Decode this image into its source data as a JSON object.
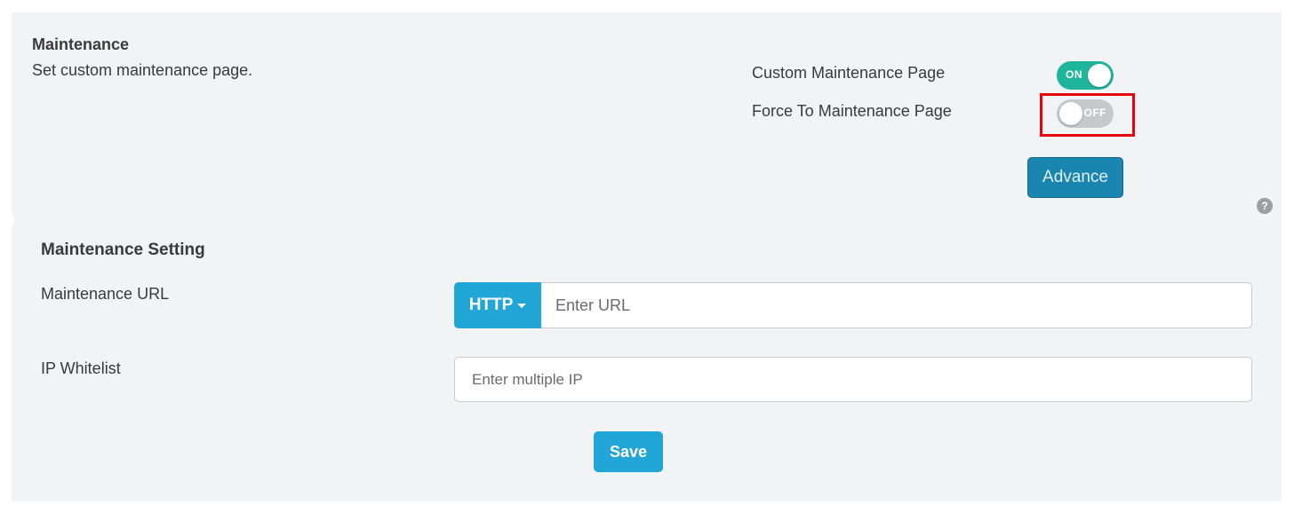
{
  "header": {
    "title": "Maintenance",
    "subtitle": "Set custom maintenance page."
  },
  "options": [
    {
      "label": "Custom Maintenance Page",
      "state": "ON",
      "enabled": true
    },
    {
      "label": "Force To Maintenance Page",
      "state": "OFF",
      "enabled": false
    }
  ],
  "advance_label": "Advance",
  "help_icon": "?",
  "settings": {
    "title": "Maintenance Setting",
    "url_label": "Maintenance URL",
    "protocol": "HTTP",
    "url_placeholder": "Enter URL",
    "ip_label": "IP Whitelist",
    "ip_placeholder": "Enter multiple IP",
    "save_label": "Save"
  },
  "colors": {
    "panel_bg": "#f2f3f5",
    "toggle_on": "#1fb59d",
    "toggle_off": "#c6c8cc",
    "primary": "#22a6d8",
    "advance": "#1a86b0",
    "highlight": "#e8000b"
  },
  "icons": {
    "help": "help-icon",
    "dropdown": "caret-down-icon"
  }
}
